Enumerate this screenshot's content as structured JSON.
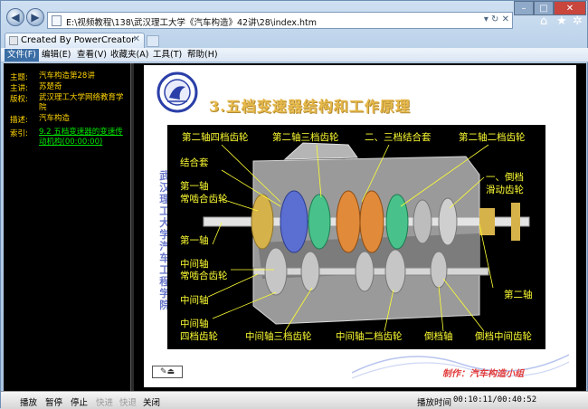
{
  "browser": {
    "back_icon": "back-arrow-icon",
    "forward_icon": "forward-arrow-icon",
    "address": "E:\\视频教程\\138\\武汉理工大学《汽车构造》42讲\\28\\index.htm",
    "window_controls": [
      "–",
      "□",
      "✕"
    ],
    "tab_title": "Created By PowerCreator",
    "menu": [
      "文件(F)",
      "编辑(E)",
      "查看(V)",
      "收藏夹(A)",
      "工具(T)",
      "帮助(H)"
    ]
  },
  "info": {
    "rows": [
      {
        "key": "主题:",
        "value": "汽车构造第28讲"
      },
      {
        "key": "主讲:",
        "value": "苏楚奇"
      },
      {
        "key": "版权:",
        "value": "武汉理工大学网络教育学院"
      },
      {
        "key": "描述:",
        "value": "汽车构造"
      },
      {
        "key": "索引:",
        "value": "9.2 五档变速器的变速传动机构(00:00:00)"
      }
    ]
  },
  "slide": {
    "title": "3.五档变速器结构和工作原理",
    "vertical_text": "武汉理工大学汽车工程学院",
    "caption": "制作：汽车构造小组",
    "labels": {
      "l1": "第二轴四档齿轮",
      "l2": "第二轴三档齿轮",
      "l3": "二、三档结合套",
      "l4": "第二轴二档齿轮",
      "l5": "结合套",
      "l6": "一、倒档",
      "l7": "滑动齿轮",
      "l8": "第一轴",
      "l9": "常啮合齿轮",
      "l10": "第一轴",
      "l11": "中间轴",
      "l12": "常啮合齿轮",
      "l13": "中间轴",
      "l14": "第二轴",
      "l15": "中间轴",
      "l16": "四档齿轮",
      "l17": "中间轴三档齿轮",
      "l18": "中间轴二档齿轮",
      "l19": "倒档轴",
      "l20": "倒档中间齿轮"
    }
  },
  "player": {
    "buttons": [
      "播放",
      "暂停",
      "停止",
      "快进",
      "快退",
      "关闭"
    ],
    "disabled": [
      false,
      false,
      false,
      true,
      true,
      false
    ],
    "time_label": "播放时间",
    "time": "00:10:11/00:40:52"
  },
  "colors": {
    "label": "#ffff33",
    "info_text": "#ffd400",
    "link": "#00e800",
    "title": "#e7b94a"
  }
}
